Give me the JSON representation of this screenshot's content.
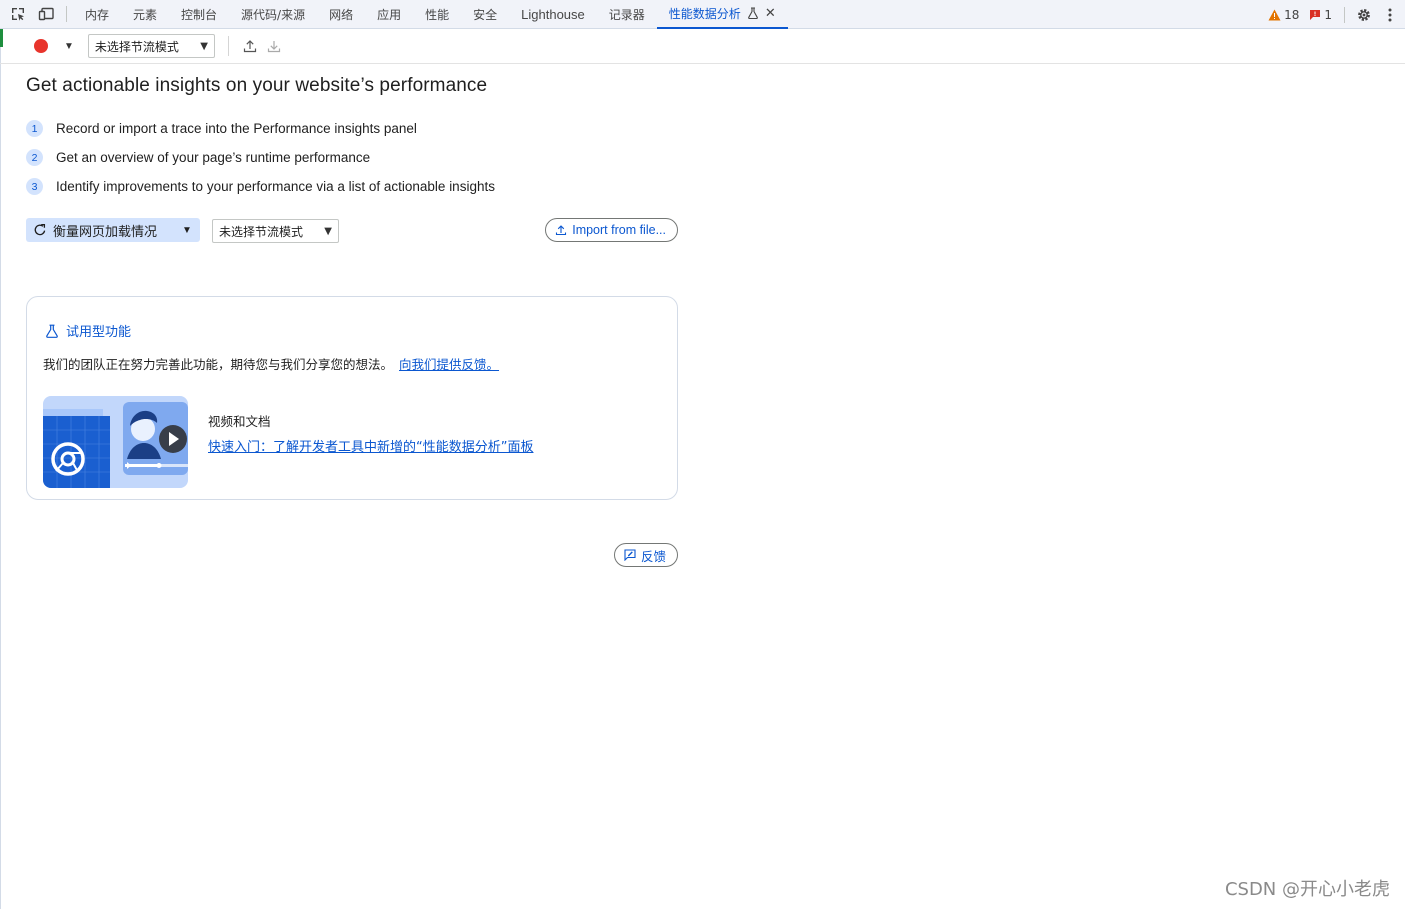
{
  "tabs": [
    {
      "label": "内存"
    },
    {
      "label": "元素"
    },
    {
      "label": "控制台"
    },
    {
      "label": "源代码/来源"
    },
    {
      "label": "网络"
    },
    {
      "label": "应用"
    },
    {
      "label": "性能"
    },
    {
      "label": "安全"
    },
    {
      "label": "Lighthouse"
    },
    {
      "label": "记录器"
    },
    {
      "label": "性能数据分析",
      "active": true
    }
  ],
  "status": {
    "warnings": "18",
    "issues": "1"
  },
  "toolbar": {
    "throttle_select": "未选择节流模式"
  },
  "main": {
    "headline": "Get actionable insights on your website’s performance",
    "steps": [
      {
        "num": "1",
        "text": "Record or import a trace into the Performance insights panel"
      },
      {
        "num": "2",
        "text": "Get an overview of your page’s runtime performance"
      },
      {
        "num": "3",
        "text": "Identify improvements to your performance via a list of actionable insights"
      }
    ],
    "measure_label": "衡量网页加载情况",
    "throttle_select": "未选择节流模式",
    "import_label": "Import from file..."
  },
  "card": {
    "title": "试用型功能",
    "text": "我们的团队正在努力完善此功能，期待您与我们分享您的想法。",
    "feedback_link": "向我们提供反馈。",
    "video_label": "视频和文档",
    "video_link": "快速入门：了解开发者工具中新增的“性能数据分析”面板"
  },
  "feedback_label": "反馈",
  "watermark": "CSDN @开心小老虎",
  "colors": {
    "accent": "#0b57d0",
    "record": "#e8342c",
    "warning": "#e37400",
    "error": "#d93025"
  }
}
